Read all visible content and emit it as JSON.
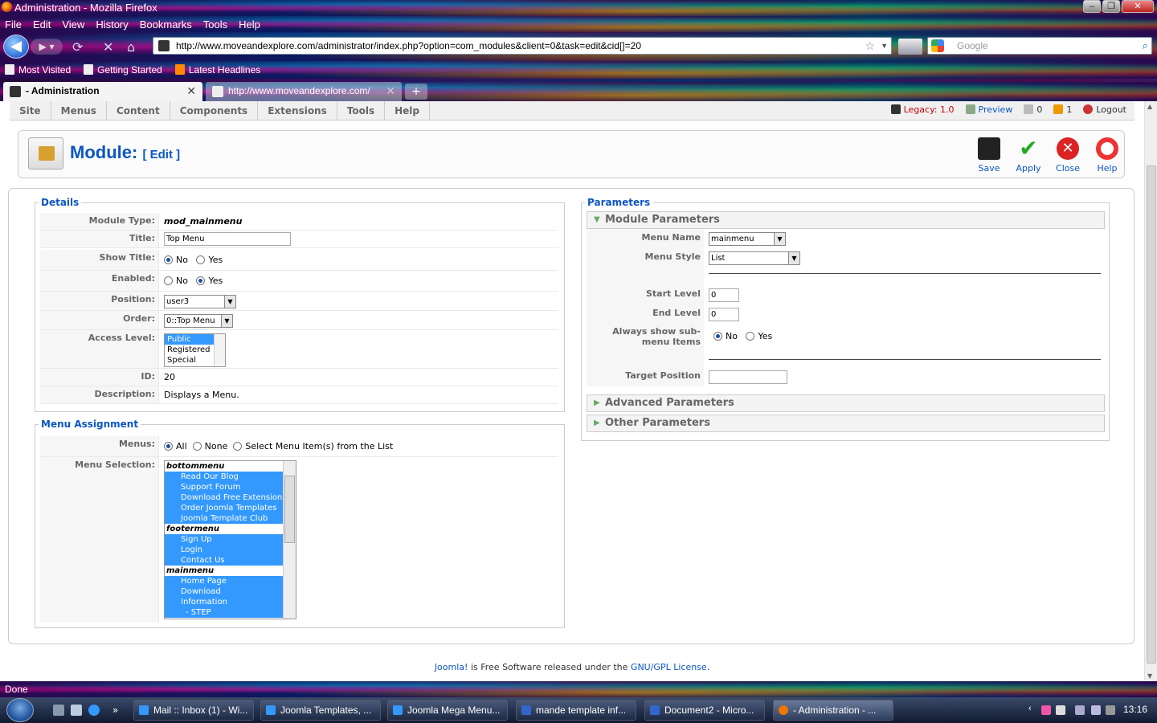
{
  "window": {
    "title": "Administration - Mozilla Firefox"
  },
  "menubar": [
    "File",
    "Edit",
    "View",
    "History",
    "Bookmarks",
    "Tools",
    "Help"
  ],
  "nav": {
    "url": "http://www.moveandexplore.com/administrator/index.php?option=com_modules&client=0&task=edit&cid[]=20",
    "search_placeholder": "Google"
  },
  "bookmarks": [
    "Most Visited",
    "Getting Started",
    "Latest Headlines"
  ],
  "tabs": [
    {
      "label": "- Administration"
    },
    {
      "label": "http://www.moveandexplore.com/"
    }
  ],
  "admin_menu": [
    "Site",
    "Menus",
    "Content",
    "Components",
    "Extensions",
    "Tools",
    "Help"
  ],
  "admin_status": {
    "legacy": "Legacy: 1.0",
    "preview": "Preview",
    "messages": "0",
    "users": "1",
    "logout": "Logout"
  },
  "page": {
    "title": "Module:",
    "subtitle": "[ Edit ]"
  },
  "toolbar": {
    "save": "Save",
    "apply": "Apply",
    "close": "Close",
    "help": "Help"
  },
  "details": {
    "legend": "Details",
    "module_type_label": "Module Type:",
    "module_type": "mod_mainmenu",
    "title_label": "Title:",
    "title_value": "Top Menu",
    "show_title_label": "Show Title:",
    "no": "No",
    "yes": "Yes",
    "enabled_label": "Enabled:",
    "position_label": "Position:",
    "position_value": "user3",
    "order_label": "Order:",
    "order_value": "0::Top Menu",
    "access_label": "Access Level:",
    "access_options": [
      "Public",
      "Registered",
      "Special"
    ],
    "id_label": "ID:",
    "id_value": "20",
    "desc_label": "Description:",
    "desc_value": "Displays a Menu."
  },
  "assignment": {
    "legend": "Menu Assignment",
    "menus_label": "Menus:",
    "all": "All",
    "none": "None",
    "select": "Select Menu Item(s) from the List",
    "selection_label": "Menu Selection:",
    "groups": [
      {
        "name": "bottommenu",
        "items": [
          "Read Our Blog",
          "Support Forum",
          "Download Free Extensions",
          "Order Joomla Templates",
          "Joomla Template Club"
        ]
      },
      {
        "name": "footermenu",
        "items": [
          "Sign Up",
          "Login",
          "Contact Us"
        ]
      },
      {
        "name": "mainmenu",
        "items": [
          "Home Page",
          "Download",
          "Information",
          " - STEP"
        ]
      }
    ]
  },
  "parameters": {
    "legend": "Parameters",
    "module_params": "Module Parameters",
    "menu_name_label": "Menu Name",
    "menu_name": "mainmenu",
    "menu_style_label": "Menu Style",
    "menu_style": "List",
    "start_level_label": "Start Level",
    "start_level": "0",
    "end_level_label": "End Level",
    "end_level": "0",
    "always_show_label": "Always show sub-menu Items",
    "no": "No",
    "yes": "Yes",
    "target_label": "Target Position",
    "target_value": "",
    "advanced": "Advanced Parameters",
    "other": "Other Parameters"
  },
  "footer": {
    "joomla": "Joomla!",
    "middle": " is Free Software released under the ",
    "license": "GNU/GPL License",
    "end": "."
  },
  "statusbar": "Done",
  "taskbar": {
    "tasks": [
      "Mail :: Inbox (1) - Wi...",
      "Joomla Templates, ...",
      "Joomla Mega Menu...",
      "mande template inf...",
      "Document2 - Micro...",
      "- Administration - ..."
    ],
    "clock": "13:16"
  }
}
